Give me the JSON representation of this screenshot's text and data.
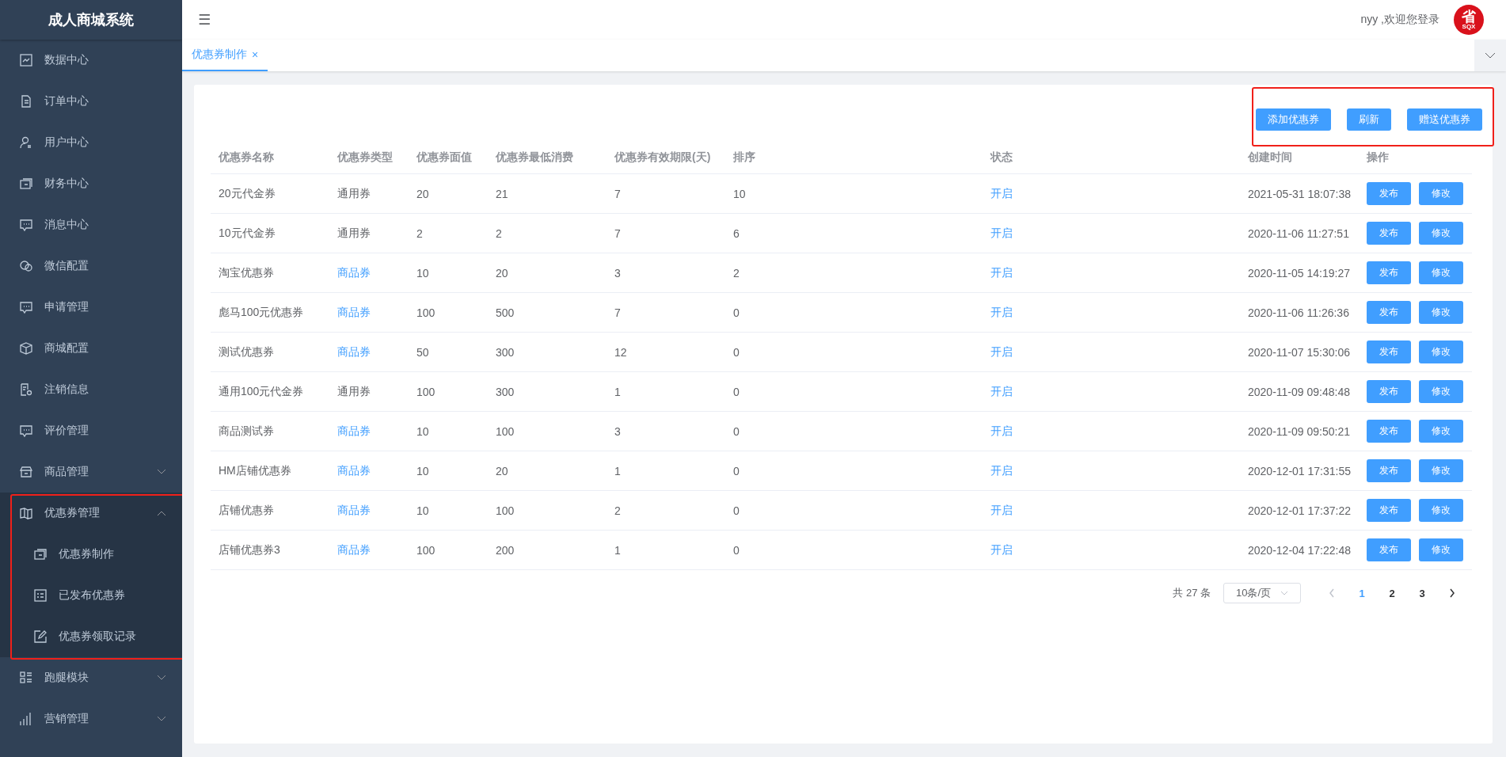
{
  "sidebar": {
    "title": "成人商城系统",
    "items": [
      {
        "label": "数据中心"
      },
      {
        "label": "订单中心"
      },
      {
        "label": "用户中心"
      },
      {
        "label": "财务中心"
      },
      {
        "label": "消息中心"
      },
      {
        "label": "微信配置"
      },
      {
        "label": "申请管理"
      },
      {
        "label": "商城配置"
      },
      {
        "label": "注销信息"
      },
      {
        "label": "评价管理"
      },
      {
        "label": "商品管理",
        "expanded": false
      },
      {
        "label": "优惠券管理",
        "expanded": true,
        "highlighted": true,
        "children": [
          {
            "label": "优惠券制作"
          },
          {
            "label": "已发布优惠券"
          },
          {
            "label": "优惠券领取记录"
          }
        ]
      },
      {
        "label": "跑腿模块",
        "expanded": false
      },
      {
        "label": "营销管理",
        "expanded": false
      }
    ]
  },
  "header": {
    "menu_glyph": "☰",
    "welcome": "nyy ,欢迎您登录",
    "avatar": {
      "glyph": "省",
      "caption": "SQX"
    }
  },
  "tabs": [
    {
      "label": "优惠券制作",
      "selected": true,
      "close": "×"
    }
  ],
  "toolbar": {
    "highlighted": true,
    "buttons": [
      "添加优惠券",
      "刷新",
      "赠送优惠券"
    ]
  },
  "table": {
    "columns": [
      "优惠券名称",
      "优惠券类型",
      "优惠券面值",
      "优惠券最低消费",
      "优惠券有效期限(天)",
      "排序",
      "状态",
      "创建时间",
      "操作"
    ],
    "rows": [
      {
        "name": "20元代金券",
        "type": "通用券",
        "type_link": false,
        "value": "20",
        "min_spend": "21",
        "valid_days": "7",
        "sort": "10",
        "status": "开启",
        "created": "2021-05-31 18:07:38",
        "actions": [
          "发布",
          "修改"
        ]
      },
      {
        "name": "10元代金券",
        "type": "通用券",
        "type_link": false,
        "value": "2",
        "min_spend": "2",
        "valid_days": "7",
        "sort": "6",
        "status": "开启",
        "created": "2020-11-06 11:27:51",
        "actions": [
          "发布",
          "修改"
        ]
      },
      {
        "name": "淘宝优惠券",
        "type": "商品券",
        "type_link": true,
        "value": "10",
        "min_spend": "20",
        "valid_days": "3",
        "sort": "2",
        "status": "开启",
        "created": "2020-11-05 14:19:27",
        "actions": [
          "发布",
          "修改"
        ]
      },
      {
        "name": "彪马100元优惠券",
        "type": "商品券",
        "type_link": true,
        "value": "100",
        "min_spend": "500",
        "valid_days": "7",
        "sort": "0",
        "status": "开启",
        "created": "2020-11-06 11:26:36",
        "actions": [
          "发布",
          "修改"
        ]
      },
      {
        "name": "测试优惠券",
        "type": "商品券",
        "type_link": true,
        "value": "50",
        "min_spend": "300",
        "valid_days": "12",
        "sort": "0",
        "status": "开启",
        "created": "2020-11-07 15:30:06",
        "actions": [
          "发布",
          "修改"
        ]
      },
      {
        "name": "通用100元代金券",
        "type": "通用券",
        "type_link": false,
        "value": "100",
        "min_spend": "300",
        "valid_days": "1",
        "sort": "0",
        "status": "开启",
        "created": "2020-11-09 09:48:48",
        "actions": [
          "发布",
          "修改"
        ]
      },
      {
        "name": "商品测试券",
        "type": "商品券",
        "type_link": true,
        "value": "10",
        "min_spend": "100",
        "valid_days": "3",
        "sort": "0",
        "status": "开启",
        "created": "2020-11-09 09:50:21",
        "actions": [
          "发布",
          "修改"
        ]
      },
      {
        "name": "HM店铺优惠券",
        "type": "商品券",
        "type_link": true,
        "value": "10",
        "min_spend": "20",
        "valid_days": "1",
        "sort": "0",
        "status": "开启",
        "created": "2020-12-01 17:31:55",
        "actions": [
          "发布",
          "修改"
        ]
      },
      {
        "name": "店铺优惠券",
        "type": "商品券",
        "type_link": true,
        "value": "10",
        "min_spend": "100",
        "valid_days": "2",
        "sort": "0",
        "status": "开启",
        "created": "2020-12-01 17:37:22",
        "actions": [
          "发布",
          "修改"
        ]
      },
      {
        "name": "店铺优惠券3",
        "type": "商品券",
        "type_link": true,
        "value": "100",
        "min_spend": "200",
        "valid_days": "1",
        "sort": "0",
        "status": "开启",
        "created": "2020-12-04 17:22:48",
        "actions": [
          "发布",
          "修改"
        ]
      }
    ]
  },
  "pagination": {
    "total": "共 27 条",
    "page_size": "10条/页",
    "pages": [
      {
        "label": "1",
        "selected": true
      },
      {
        "label": "2",
        "selected": false
      },
      {
        "label": "3",
        "selected": false
      }
    ]
  }
}
